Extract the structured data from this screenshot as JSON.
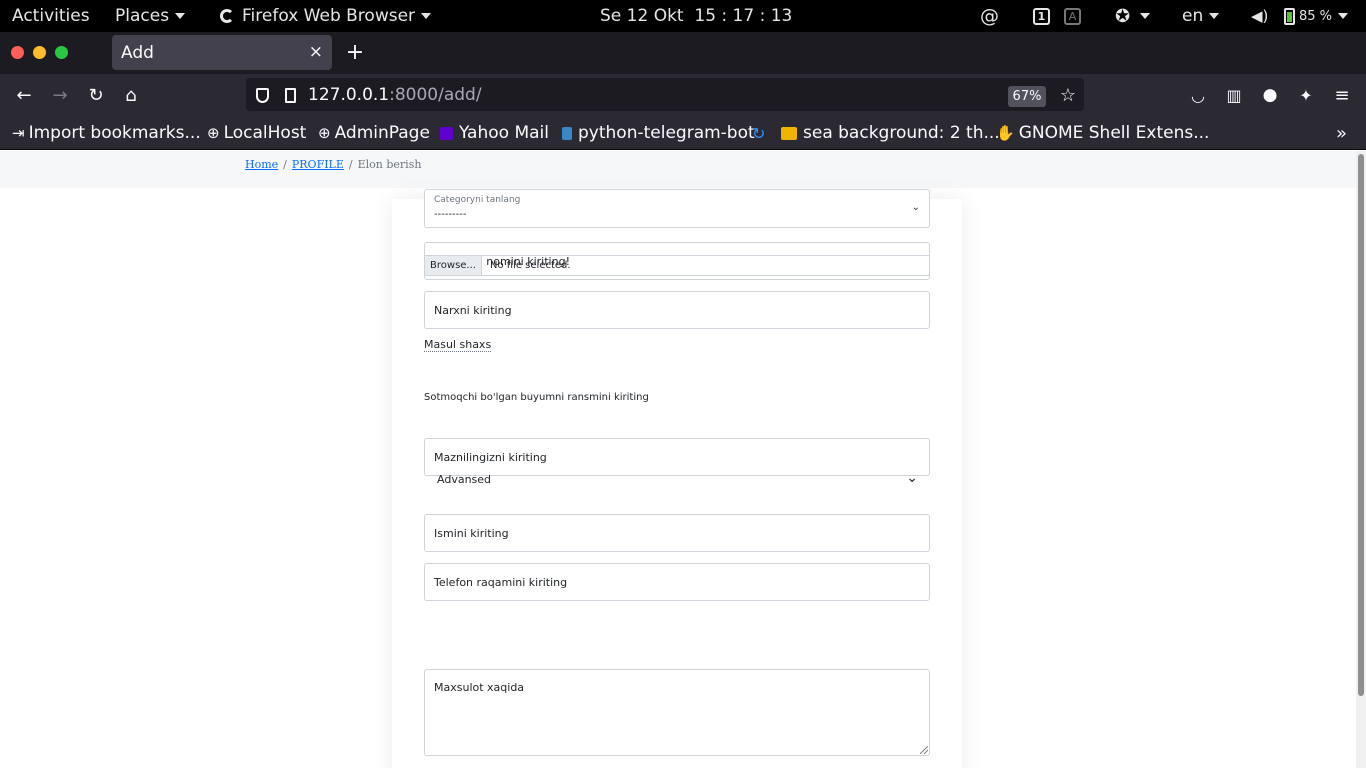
{
  "gnome": {
    "activities": "Activities",
    "places": "Places",
    "app_menu": "Firefox Web Browser",
    "clock": "Se 12 Okt  15 : 17 : 13",
    "workspace": "1",
    "input_indicator": "A",
    "language": "en",
    "battery": "85 %"
  },
  "browser": {
    "tab_title": "Add",
    "tab_close": "×",
    "new_tab": "+",
    "url_host": "127.0.0.1",
    "url_rest": ":8000/add/",
    "zoom": "67%",
    "window_controls": {
      "close": "#ff5f57",
      "minimize": "#febc2e",
      "maximize": "#28c840"
    }
  },
  "bookmarks": [
    {
      "label": "Import bookmarks...",
      "icon": "import-icon"
    },
    {
      "label": "LocalHost",
      "icon": "globe-icon"
    },
    {
      "label": "AdminPage",
      "icon": "globe-icon"
    },
    {
      "label": "Yahoo Mail",
      "icon": "yahoo-icon"
    },
    {
      "label": "python-telegram-bot",
      "icon": "python-icon"
    },
    {
      "label": "",
      "icon": "loop-icon"
    },
    {
      "label": "sea background: 2 th...",
      "icon": "image-icon"
    },
    {
      "label": "GNOME Shell Extens...",
      "icon": "gnome-icon"
    }
  ],
  "breadcrumb": {
    "home": "Home",
    "profile": "PROFILE",
    "current": "Elon berish",
    "separator": "/"
  },
  "form": {
    "name_placeholder": "Buyumni nomini kiriting!",
    "price_placeholder": "Narxni kiriting",
    "category_label": "Categoryni tanlang",
    "category_value": "---------",
    "image_label": "Sotmoqchi bo'lgan buyumni ransmini kiriting",
    "file_button": "Browse...",
    "file_status": "No file selected.",
    "address_placeholder": "Maznilingizni kiriting",
    "responsible_label": "Masul shaxs",
    "person_name_placeholder": "Ismini kiriting",
    "phone_placeholder": "Telefon raqamini kiriting",
    "advanced_label": "Advansed",
    "description_placeholder": "Maxsulot xaqida"
  }
}
